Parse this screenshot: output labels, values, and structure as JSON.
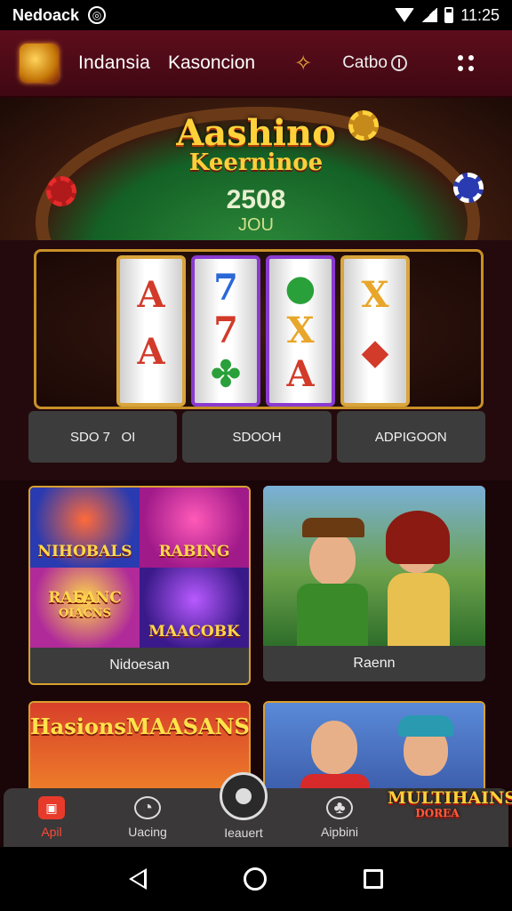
{
  "status_bar": {
    "carrier": "Nedoack",
    "time": "11:25"
  },
  "header": {
    "title": "Indansia",
    "title2": "Kasoncion",
    "category": "Catbo"
  },
  "hero": {
    "title": "Aashino",
    "subtitle": "Keerninoe",
    "number": "2508",
    "sub_number": "JOU"
  },
  "slots": {
    "reels": [
      [
        "A",
        "A",
        ""
      ],
      [
        "7",
        "7",
        ""
      ],
      [
        "",
        "X",
        "A"
      ],
      [
        "X",
        "",
        ""
      ]
    ],
    "labels": [
      "SDO 7   OI",
      "SDOOH",
      "ADPIGOON"
    ]
  },
  "cards": [
    {
      "caption": "Nidoesan",
      "tiles": [
        "NIHOBALS",
        "RABING",
        "RAEANC",
        "MAACOBK"
      ],
      "tile3_sub": "OIACNS"
    },
    {
      "caption": "Raenn"
    },
    {
      "tiles": [
        "Hasions",
        "MAASANS"
      ]
    },
    {
      "tiles": []
    }
  ],
  "promo": {
    "title": "MULTIHAINS",
    "sub": "DOREA"
  },
  "bottom_nav": [
    {
      "label": "Apil",
      "icon": "home-icon"
    },
    {
      "label": "Uacing",
      "icon": "chat-icon"
    },
    {
      "label": "Ieauert",
      "icon": "center-action-icon"
    },
    {
      "label": "Aipbini",
      "icon": "club-icon"
    }
  ],
  "colors": {
    "header": "#5e0d1c",
    "accent": "#ffd23a",
    "active_nav": "#ff4a3a"
  }
}
